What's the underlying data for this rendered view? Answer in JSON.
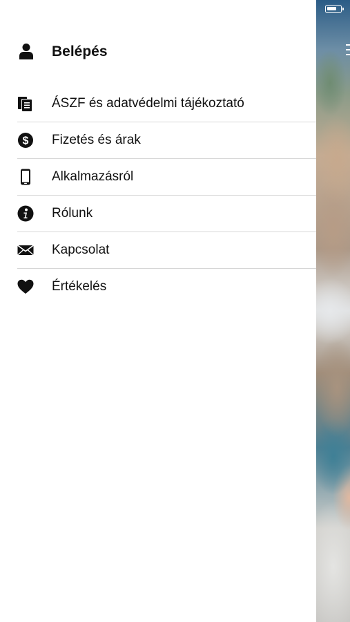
{
  "status_bar": {
    "battery_icon": "battery-icon"
  },
  "drawer": {
    "login": {
      "label": "Belépés",
      "icon": "user-icon"
    },
    "items": [
      {
        "label": "ÁSZF és adatvédelmi tájékoztató",
        "icon": "documents-icon"
      },
      {
        "label": "Fizetés és árak",
        "icon": "dollar-circle-icon"
      },
      {
        "label": "Alkalmazásról",
        "icon": "mobile-phone-icon"
      },
      {
        "label": "Rólunk",
        "icon": "info-circle-icon"
      },
      {
        "label": "Kapcsolat",
        "icon": "envelope-icon"
      },
      {
        "label": "Értékelés",
        "icon": "heart-icon"
      }
    ]
  },
  "background_app": {
    "menu_icon": "hamburger-menu-icon"
  },
  "colors": {
    "text": "#111111",
    "divider": "#d6d6d6",
    "drawer_bg": "#ffffff"
  }
}
